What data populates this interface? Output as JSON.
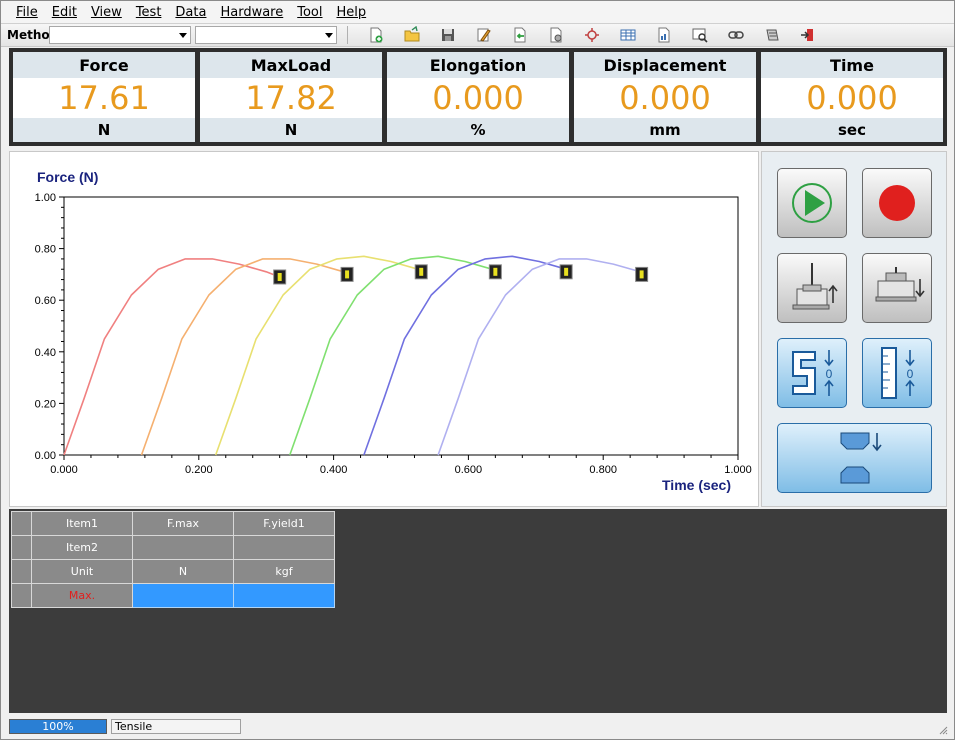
{
  "menu": [
    {
      "key": "file",
      "label": "File"
    },
    {
      "key": "edit",
      "label": "Edit"
    },
    {
      "key": "view",
      "label": "View"
    },
    {
      "key": "test",
      "label": "Test"
    },
    {
      "key": "data",
      "label": "Data"
    },
    {
      "key": "hardware",
      "label": "Hardware"
    },
    {
      "key": "tool",
      "label": "Tool"
    },
    {
      "key": "help",
      "label": "Help"
    }
  ],
  "toolbar": {
    "method_label": "Method",
    "method_value": "",
    "secondary_value": "",
    "icons": [
      "new-file-icon",
      "open-folder-icon",
      "save-icon",
      "edit-icon",
      "import-icon",
      "settings-file-icon",
      "calibration-icon",
      "table-icon",
      "report-icon",
      "preview-icon",
      "link-icon",
      "print-icon",
      "exit-icon"
    ]
  },
  "readouts": [
    {
      "label": "Force",
      "value": "17.61",
      "unit": "N"
    },
    {
      "label": "MaxLoad",
      "value": "17.82",
      "unit": "N"
    },
    {
      "label": "Elongation",
      "value": "0.000",
      "unit": "%"
    },
    {
      "label": "Displacement",
      "value": "0.000",
      "unit": "mm"
    },
    {
      "label": "Time",
      "value": "0.000",
      "unit": "sec"
    }
  ],
  "chart_data": {
    "type": "line",
    "ylabel": "Force (N)",
    "xlabel": "Time (sec)",
    "xlim": [
      0,
      1.0
    ],
    "ylim": [
      0,
      1.0
    ],
    "x_ticks": [
      "0.000",
      "0.200",
      "0.400",
      "0.600",
      "0.800",
      "1.000"
    ],
    "y_ticks": [
      "0.00",
      "0.20",
      "0.40",
      "0.60",
      "0.80",
      "1.00"
    ],
    "grid": false,
    "series": [
      {
        "color": "#f08080",
        "x": [
          0.0,
          0.03,
          0.06,
          0.1,
          0.14,
          0.18,
          0.22,
          0.26,
          0.3,
          0.32
        ],
        "y": [
          0.0,
          0.22,
          0.45,
          0.62,
          0.72,
          0.76,
          0.76,
          0.74,
          0.71,
          0.69
        ]
      },
      {
        "color": "#f5b070",
        "x": [
          0.115,
          0.145,
          0.175,
          0.215,
          0.255,
          0.295,
          0.335,
          0.375,
          0.415,
          0.42
        ],
        "y": [
          0.0,
          0.22,
          0.45,
          0.62,
          0.72,
          0.76,
          0.76,
          0.74,
          0.71,
          0.7
        ]
      },
      {
        "color": "#e8e070",
        "x": [
          0.225,
          0.255,
          0.285,
          0.325,
          0.365,
          0.405,
          0.445,
          0.485,
          0.525,
          0.53
        ],
        "y": [
          0.0,
          0.22,
          0.45,
          0.62,
          0.72,
          0.76,
          0.77,
          0.75,
          0.72,
          0.71
        ]
      },
      {
        "color": "#80e070",
        "x": [
          0.335,
          0.365,
          0.395,
          0.435,
          0.475,
          0.515,
          0.555,
          0.595,
          0.635,
          0.64
        ],
        "y": [
          0.0,
          0.22,
          0.45,
          0.62,
          0.72,
          0.76,
          0.77,
          0.75,
          0.72,
          0.71
        ]
      },
      {
        "color": "#7070e0",
        "x": [
          0.445,
          0.475,
          0.505,
          0.545,
          0.585,
          0.625,
          0.665,
          0.705,
          0.745,
          0.75
        ],
        "y": [
          0.0,
          0.22,
          0.45,
          0.62,
          0.72,
          0.76,
          0.77,
          0.75,
          0.72,
          0.71
        ]
      },
      {
        "color": "#b0b0f0",
        "x": [
          0.555,
          0.585,
          0.615,
          0.655,
          0.695,
          0.735,
          0.775,
          0.815,
          0.855,
          0.86
        ],
        "y": [
          0.0,
          0.22,
          0.45,
          0.62,
          0.72,
          0.76,
          0.76,
          0.74,
          0.71,
          0.7
        ]
      }
    ],
    "markers": [
      {
        "x": 0.32,
        "y": 0.69
      },
      {
        "x": 0.42,
        "y": 0.7
      },
      {
        "x": 0.53,
        "y": 0.71
      },
      {
        "x": 0.64,
        "y": 0.71
      },
      {
        "x": 0.745,
        "y": 0.71
      },
      {
        "x": 0.857,
        "y": 0.7
      }
    ]
  },
  "control_buttons": [
    {
      "key": "start",
      "icon": "play-icon"
    },
    {
      "key": "record",
      "icon": "record-icon"
    },
    {
      "key": "crosshead-up",
      "icon": "crosshead-up-icon"
    },
    {
      "key": "crosshead-down",
      "icon": "crosshead-down-icon"
    },
    {
      "key": "zero-force",
      "icon": "zero-force-icon"
    },
    {
      "key": "zero-displacement",
      "icon": "zero-displacement-icon"
    },
    {
      "key": "return-grip",
      "icon": "grip-return-icon"
    }
  ],
  "results_table": {
    "rows": [
      [
        "Item1",
        "F.max",
        "F.yield1"
      ],
      [
        "Item2",
        "",
        ""
      ],
      [
        "Unit",
        "N",
        "kgf"
      ],
      [
        "Max.",
        "",
        ""
      ]
    ]
  },
  "status": {
    "progress_percent": 100,
    "progress_label": "100%",
    "mode": "Tensile"
  },
  "colors": {
    "accent_value": "#e89a1e",
    "panel_dark": "#2e2e2e",
    "table_bg": "#3c3c3c",
    "selection_blue": "#3399ff"
  }
}
